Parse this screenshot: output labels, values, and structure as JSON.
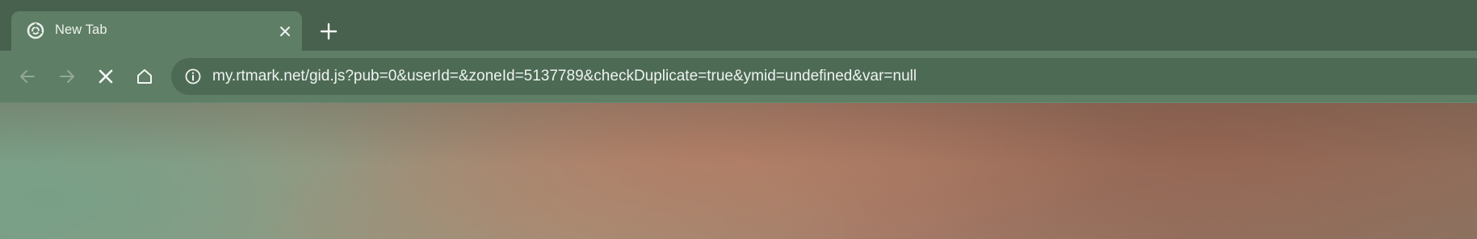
{
  "tab": {
    "title": "New Tab",
    "favicon": "loading-spinner-icon",
    "close_icon": "close-icon"
  },
  "tabstrip": {
    "new_tab_icon": "plus-icon"
  },
  "toolbar": {
    "back_icon": "arrow-left-icon",
    "forward_icon": "arrow-right-icon",
    "stop_icon": "close-icon",
    "home_icon": "home-icon"
  },
  "omnibox": {
    "info_icon": "info-icon",
    "url": "my.rtmark.net/gid.js?pub=0&userId=&zoneId=5137789&checkDuplicate=true&ymid=undefined&var=null"
  },
  "colors": {
    "tabstrip_bg": "#48614f",
    "active_tab_bg": "#5e7e65",
    "omnibox_bg": "#4d6a55",
    "text": "#eef3ef"
  }
}
